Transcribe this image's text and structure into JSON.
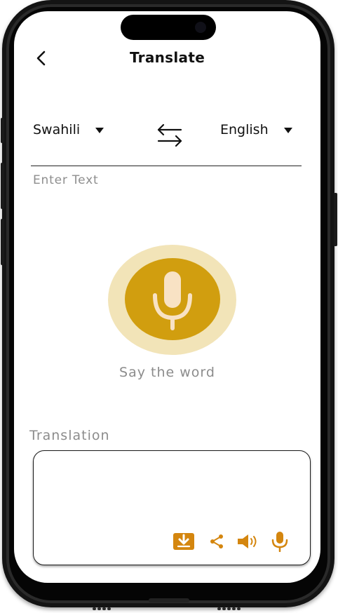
{
  "header": {
    "back_icon": "chevron-left-icon",
    "title": "Translate"
  },
  "languages": {
    "source": "Swahili",
    "target": "English",
    "swap_icon": "swap-arrows-icon",
    "dropdown_icon": "caret-down-icon"
  },
  "input": {
    "placeholder": "Enter Text",
    "value": ""
  },
  "voice": {
    "mic_icon": "microphone-icon",
    "prompt": "Say the word",
    "colors": {
      "ring": "#f2e4b8",
      "button": "#d19e0f",
      "icon": "#f8e2c4"
    }
  },
  "translation": {
    "label": "Translation",
    "output": "",
    "actions": [
      {
        "name": "download",
        "icon": "download-icon"
      },
      {
        "name": "share",
        "icon": "share-icon"
      },
      {
        "name": "speak",
        "icon": "speaker-icon"
      },
      {
        "name": "record",
        "icon": "microphone-icon"
      }
    ],
    "action_color": "#d4860f"
  }
}
